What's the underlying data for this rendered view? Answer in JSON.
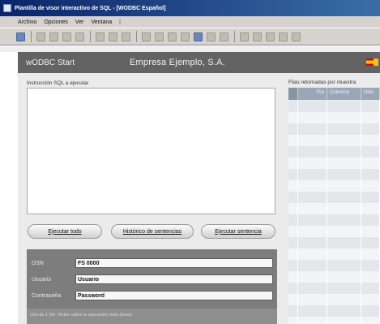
{
  "window": {
    "title": "Plantilla de visor interactivo de SQL - [WODBC Español]"
  },
  "menu": {
    "items": [
      "Archivo",
      "Opciones",
      "Ver",
      "Ventana"
    ],
    "separator": "|"
  },
  "toolbar": {
    "icons": [
      "save-icon",
      "print-icon",
      "cut-icon",
      "copy-icon",
      "paste-icon",
      "properties-icon",
      "find-icon",
      "zoom-icon",
      "grid-icon",
      "undo-icon",
      "redo-icon",
      "help-icon",
      "view-icon",
      "link-icon",
      "key-icon",
      "back-icon",
      "forward-icon",
      "stop-icon",
      "refresh-icon",
      "home-icon"
    ]
  },
  "header": {
    "brand": "wODBC Start",
    "company": "Empresa Ejemplo, S.A."
  },
  "sql": {
    "label": "Instrucción SQL a ejecutar",
    "value": ""
  },
  "buttons": {
    "exec_all": "Ejecutar todo",
    "history": "Histórico de sentencias",
    "exec_one": "Ejecutar sentencia"
  },
  "connection": {
    "dsn_label": "DSN",
    "dsn_value": "FS 0000",
    "user_label": "Usuario",
    "user_value": "Usuario",
    "password_label": "Contraseña",
    "password_value": "Password",
    "footer": "Use de 1 Sin. Retire sobre la operación vista (base)"
  },
  "results": {
    "label": "Filas retornadas por muestra",
    "headers": [
      "",
      "Fila",
      "Columna",
      "Ubic"
    ],
    "row_count": 20
  },
  "colors": {
    "header_bg": "#636363",
    "panel_bg": "#7d7d7d",
    "grid_header": "#9aa7b7",
    "titlebar": "#0a246a"
  }
}
